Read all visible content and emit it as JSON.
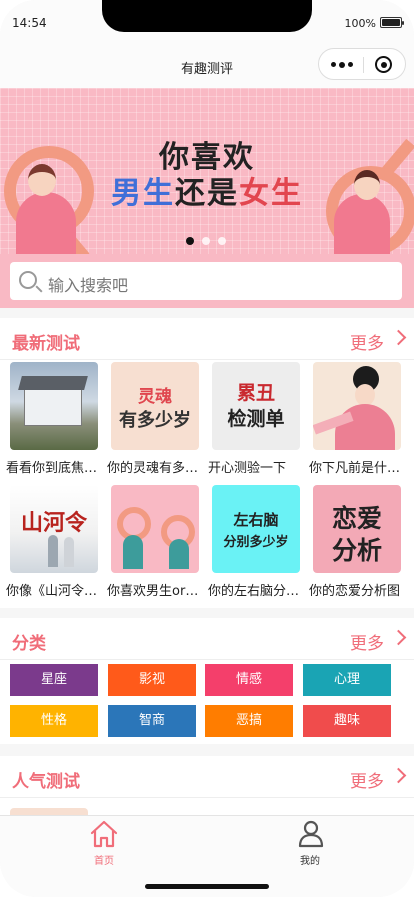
{
  "status": {
    "time": "14:54",
    "battery": "100%"
  },
  "nav": {
    "title": "有趣测评"
  },
  "banner": {
    "line1": "你喜欢",
    "line2_a": "男生",
    "line2_b": "还是",
    "line2_c": "女生",
    "slide_count": 3,
    "active_slide": 1
  },
  "search": {
    "placeholder": "输入搜索吧"
  },
  "latest": {
    "title": "最新测试",
    "more": "更多",
    "items": [
      {
        "label": "看看你到底焦虑吗",
        "thumb_text": ""
      },
      {
        "label": "你的灵魂有多少岁",
        "thumb_text_1": "灵魂",
        "thumb_text_2": "有多少岁"
      },
      {
        "label": "开心测验一下",
        "thumb_text_1": "累丑",
        "thumb_text_2": "检测单"
      },
      {
        "label": "你下凡前是什么神仙",
        "thumb_text": ""
      },
      {
        "label": "你像《山河令》里的谁",
        "thumb_text": "山河令"
      },
      {
        "label": "你喜欢男生or女生",
        "thumb_text": ""
      },
      {
        "label": "你的左右脑分别多少岁",
        "thumb_text_1": "左右脑",
        "thumb_text_2": "分别多少岁"
      },
      {
        "label": "你的恋爱分析图",
        "thumb_text_1": "恋爱",
        "thumb_text_2": "分析"
      }
    ]
  },
  "categories": {
    "title": "分类",
    "more": "更多",
    "items": [
      {
        "label": "星座",
        "color": "#7b3a8c"
      },
      {
        "label": "影视",
        "color": "#ff5a1a"
      },
      {
        "label": "情感",
        "color": "#f43f6b"
      },
      {
        "label": "心理",
        "color": "#1aa4b4"
      },
      {
        "label": "性格",
        "color": "#ffb300"
      },
      {
        "label": "智商",
        "color": "#2b76b9"
      },
      {
        "label": "恶搞",
        "color": "#ff7d00"
      },
      {
        "label": "趣味",
        "color": "#f04c4c"
      }
    ]
  },
  "popular": {
    "title": "人气测试",
    "more": "更多"
  },
  "tabbar": {
    "home": "首页",
    "mine": "我的",
    "active_color": "#f06d79"
  }
}
